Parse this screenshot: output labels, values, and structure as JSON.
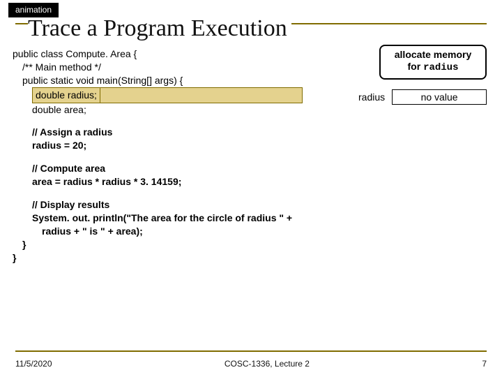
{
  "badge": "animation",
  "title": "Trace a Program Execution",
  "code": {
    "l1": "public class Compute. Area {",
    "l2": "/** Main method */",
    "l3": "public static void main(String[] args) {",
    "l4_box": "double radius;",
    "l4_rest": "double area;",
    "l5": "// Assign a radius",
    "l6": "radius = 20;",
    "l7": "// Compute area",
    "l8": "area = radius * radius * 3. 14159;",
    "l9": "// Display results",
    "l10": "System. out. println(\"The area for the circle of radius \" +",
    "l11": "radius + \" is \" + area);",
    "l12": "}",
    "l13": "}"
  },
  "callout": {
    "line1": "allocate memory",
    "line2a": "for ",
    "line2b": "radius"
  },
  "trace": {
    "label": "radius",
    "value": "no value"
  },
  "footer": {
    "left": "11/5/2020",
    "center": "COSC-1336, Lecture 2",
    "right": "7"
  }
}
